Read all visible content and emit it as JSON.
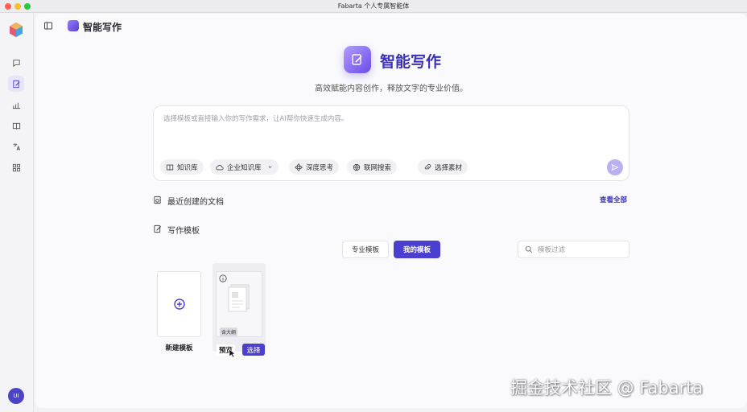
{
  "window": {
    "title": "Fabarta 个人专属智能体"
  },
  "rail": {
    "items": [
      {
        "icon": "chat-bubble-icon"
      },
      {
        "icon": "edit-document-icon",
        "active": true
      },
      {
        "icon": "chart-icon"
      },
      {
        "icon": "book-icon"
      },
      {
        "icon": "translate-icon"
      },
      {
        "icon": "grid-apps-icon"
      }
    ],
    "avatar": "UI"
  },
  "topbar": {
    "title": "智能写作"
  },
  "hero": {
    "title": "智能写作",
    "subtitle": "高效赋能内容创作，释放文字的专业价值。"
  },
  "composer": {
    "placeholder": "选择模板或直接输入你的写作需求，让AI帮你快速生成内容。",
    "chips": [
      {
        "label": "知识库",
        "icon": "book-icon"
      },
      {
        "label": "企业知识库",
        "icon": "cloud-icon"
      },
      {
        "label": "深度思考",
        "icon": "atom-icon"
      },
      {
        "label": "联网搜索",
        "icon": "globe-icon"
      },
      {
        "label": "选择素材",
        "icon": "paperclip-icon"
      }
    ]
  },
  "recent": {
    "title": "最近创建的文档",
    "view_all": "查看全部"
  },
  "templates": {
    "title": "写作模板",
    "tabs": {
      "pro": "专业模板",
      "mine": "我的模板"
    },
    "active_tab": "mine",
    "filter_placeholder": "模板过滤",
    "new_label": "新建模板",
    "item": {
      "tag": "含大纲",
      "preview": "预览",
      "select": "选择"
    }
  },
  "watermark": "掘金技术社区 @ Fabarta",
  "colors": {
    "accent": "#4b3fd0",
    "title": "#3b30b8"
  }
}
